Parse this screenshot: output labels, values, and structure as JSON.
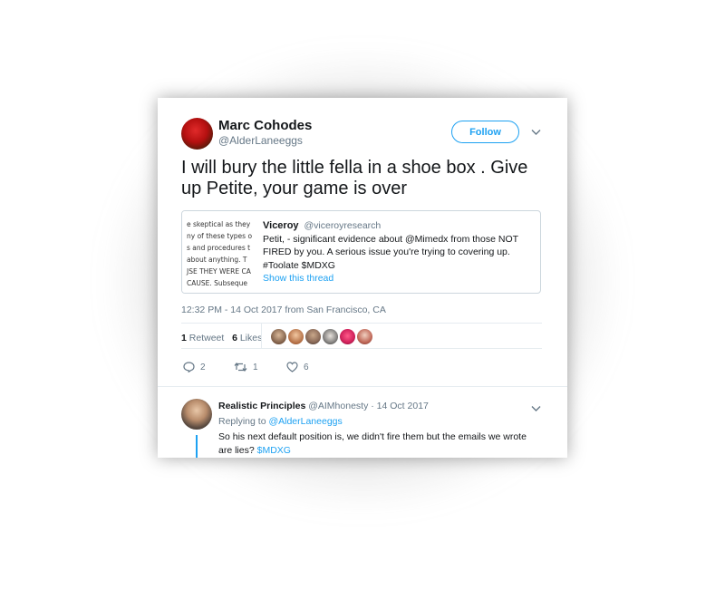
{
  "tweet": {
    "author_name": "Marc Cohodes",
    "author_handle": "@AlderLaneeggs",
    "follow_label": "Follow",
    "text": "I will bury the little fella in a shoe box . Give up Petite, your game is over",
    "timestamp": "12:32 PM - 14 Oct 2017 from San Francisco, CA",
    "retweet_count": "1",
    "retweet_label": "Retweet",
    "like_count": "6",
    "like_label": "Likes"
  },
  "quoted": {
    "name": "Viceroy",
    "handle": "@viceroyresearch",
    "text_parts": [
      "Petit, - significant evidence about @Mimedx from those NOT FIRED by you. A serious issue you're trying to covering up. #Toolate $MDXG"
    ],
    "show_thread": "Show this thread",
    "image_lines": [
      "e skeptical as they",
      "ny of these types o",
      "s and procedures t",
      "about anything.  T",
      "JSE THEY WERE CA",
      " CAUSE.  Subseque"
    ]
  },
  "actions": {
    "reply_count": "2",
    "retweet_count": "1",
    "like_count": "6"
  },
  "reply": {
    "name": "Realistic Principles",
    "handle": "@AIMhonesty",
    "date": "14 Oct 2017",
    "replying_prefix": "Replying to",
    "replying_to": "@AlderLaneeggs",
    "text": "So his next default position is, we didn't fire them but the emails we wrote are lies?",
    "cashtag": "$MDXG"
  },
  "colors": {
    "accent": "#1da1f2",
    "muted": "#657786",
    "text": "#14171a"
  }
}
